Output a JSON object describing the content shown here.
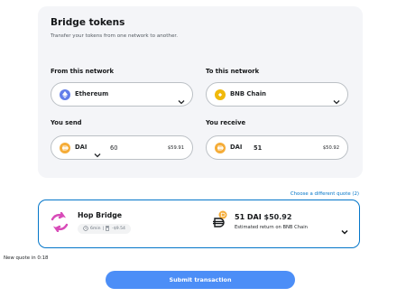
{
  "card": {
    "title": "Bridge tokens",
    "subtitle": "Transfer your tokens from one network to another."
  },
  "from": {
    "label": "From this network",
    "network": "Ethereum",
    "icon": "ethereum-icon"
  },
  "to": {
    "label": "To this network",
    "network": "BNB Chain",
    "icon": "bnb-chain-icon"
  },
  "send": {
    "label": "You send",
    "token": "DAI",
    "amount": "60",
    "usd": "$59.91",
    "icon": "dai-icon"
  },
  "receive": {
    "label": "You receive",
    "token": "DAI",
    "amount": "51",
    "usd": "$50.92",
    "icon": "dai-icon"
  },
  "quote_link": "Choose a different quote (2)",
  "quote": {
    "provider": "Hop Bridge",
    "time": "6min",
    "separator": "|",
    "fee": "-$9.54",
    "amount": "51 DAI",
    "usd": "$50.92",
    "estimate": "Estimated return on BNB Chain"
  },
  "new_quote": "New quote in 0:18",
  "submit_label": "Submit transaction",
  "colors": {
    "accent": "#0376c9",
    "button": "#4c8ef7",
    "dai": "#f5ac37",
    "bnb": "#f0b90b",
    "ethereum": "#627eea"
  }
}
